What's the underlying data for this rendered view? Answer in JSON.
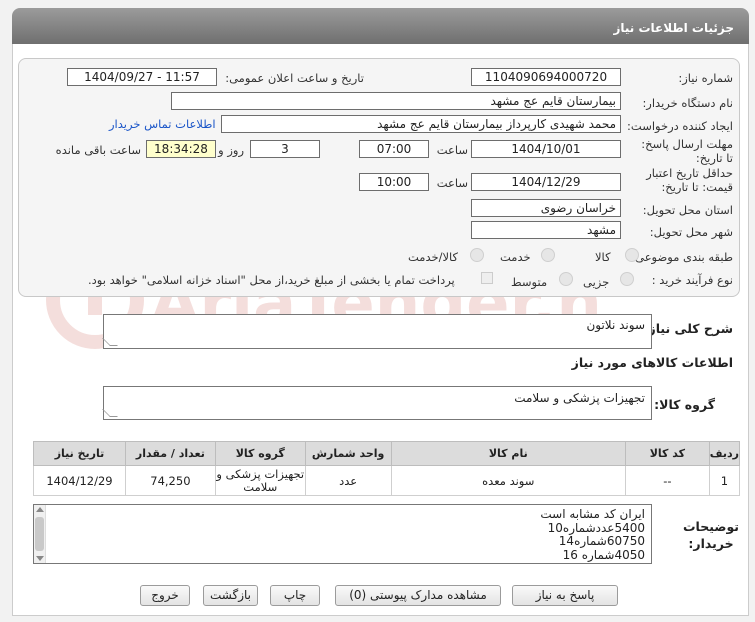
{
  "page_title": "جزئیات اطلاعات نیاز",
  "fields": {
    "need_number_label": "شماره نیاز:",
    "need_number": "1104090694000720",
    "announce_label": "تاریخ و ساعت اعلان عمومی:",
    "announce_value": "1404/09/27 - 11:57",
    "buyer_label": "نام دستگاه خریدار:",
    "buyer": "بیمارستان قایم  عج  مشهد",
    "creator_label": "ایجاد کننده درخواست:",
    "creator": "محمد شهیدی کارپرداز بیمارستان قایم  عج  مشهد",
    "contact_link": "اطلاعات تماس خریدار",
    "deadline_label": "مهلت ارسال پاسخ: تا تاریخ:",
    "deadline_date": "1404/10/01",
    "time_label": "ساعت",
    "deadline_time": "07:00",
    "days": "3",
    "days_label": "روز و",
    "remaining": "18:34:28",
    "remaining_label": "ساعت باقی مانده",
    "validity_label": "حداقل تاریخ اعتبار قیمت: تا تاریخ:",
    "validity_date": "1404/12/29",
    "validity_time": "10:00",
    "province_label": "استان محل تحویل:",
    "province": "خراسان رضوی",
    "city_label": "شهر محل تحویل:",
    "city": "مشهد",
    "category_label": "طبقه بندی موضوعی:",
    "category_options": [
      "کالا",
      "خدمت",
      "کالا/خدمت"
    ],
    "purchase_label": "نوع فرآیند خرید :",
    "purchase_options": [
      "جزیی",
      "متوسط"
    ],
    "payment_note": "پرداخت تمام یا بخشی از مبلغ خرید،از محل \"اسناد خزانه اسلامی\" خواهد بود."
  },
  "summary_label": "شرح کلی نیاز:",
  "summary": "سوند نلاتون",
  "goods_info_title": "اطلاعات کالاهای مورد نیاز",
  "goods_group_label": "گروه کالا:",
  "goods_group": "تجهیزات پزشکی و سلامت",
  "table": {
    "headers": [
      "ردیف",
      "کد کالا",
      "نام کالا",
      "واحد شمارش",
      "گروه کالا",
      "تعداد / مقدار",
      "تاریخ نیاز"
    ],
    "rows": [
      [
        "1",
        "--",
        "سوند معده",
        "عدد",
        "تجهیزات پزشکی و سلامت",
        "74,250",
        "1404/12/29"
      ]
    ]
  },
  "notes_label": "توضیحات خریدار:",
  "notes": [
    "ایران کد مشابه است",
    "5400عددشماره10",
    "60750شماره14",
    "4050شماره 16"
  ],
  "buttons": {
    "reply": "پاسخ به نیاز",
    "attachments": "مشاهده مدارک پیوستی (0)",
    "print": "چاپ",
    "back": "بازگشت",
    "exit": "خروج"
  },
  "watermark": "AriaTender.neT",
  "colors": {
    "accent_red": "#c0392b",
    "highlight": "#ffffcc"
  }
}
